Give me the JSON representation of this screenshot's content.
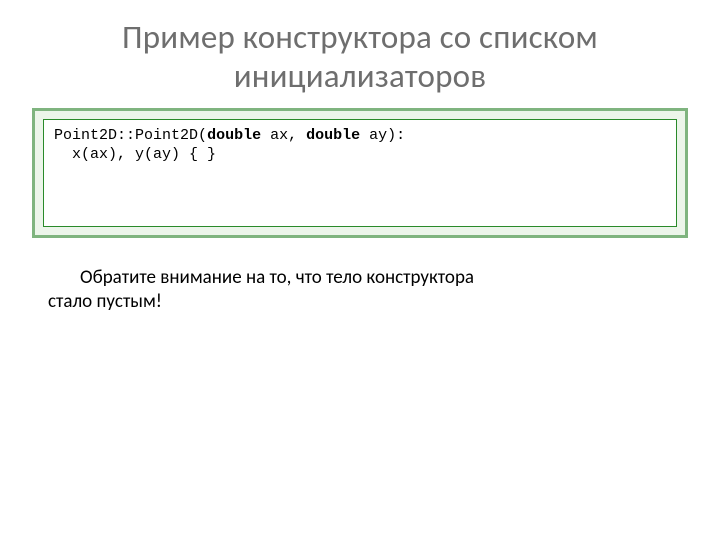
{
  "title": "Пример конструктора со списком инициализаторов",
  "code": {
    "class_name": "Point2D",
    "scope": "::",
    "ctor_name": "Point2D",
    "open_paren": "(",
    "kw_double_1": "double",
    "param1": " ax, ",
    "kw_double_2": "double",
    "param2": " ay):",
    "line2": "  x(ax), y(ay) { }"
  },
  "note_line1": "Обратите внимание на то, что тело конструктора",
  "note_line2": "стало пустым!"
}
